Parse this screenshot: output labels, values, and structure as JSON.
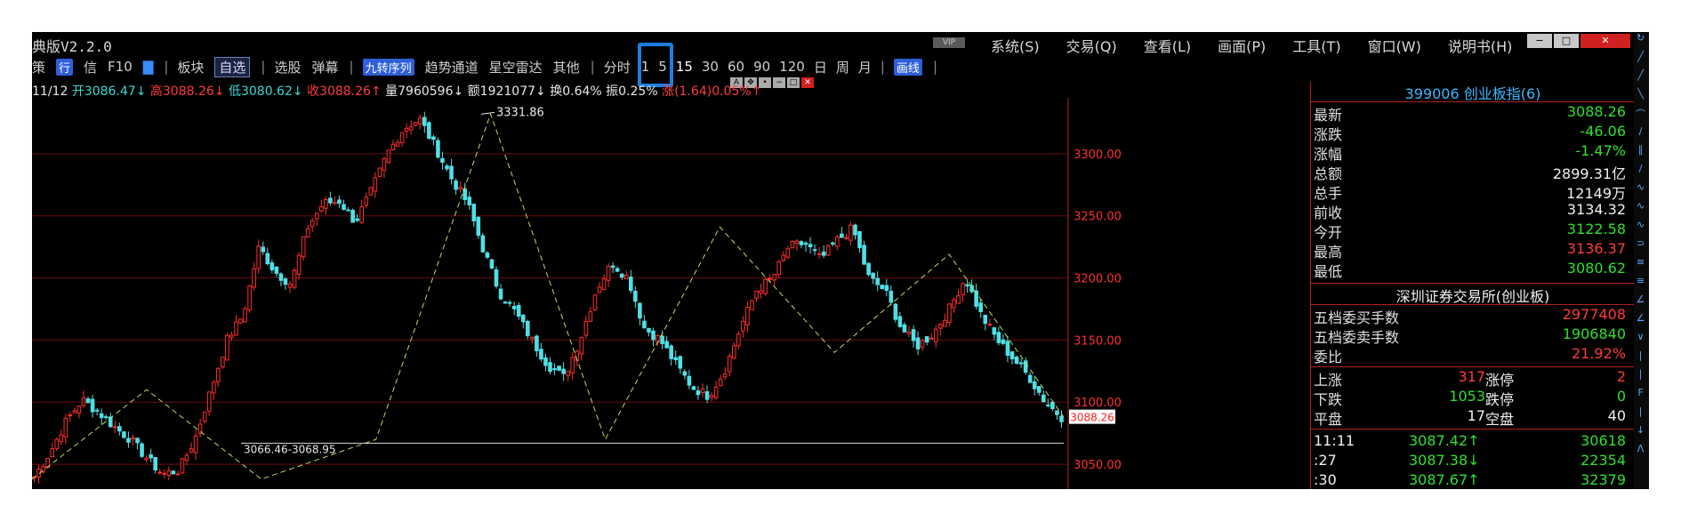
{
  "app": {
    "title": "典版V2.2.0",
    "vip_badge": "VIP",
    "menu": [
      "系统(S)",
      "交易(Q)",
      "查看(L)",
      "画面(P)",
      "工具(T)",
      "窗口(W)",
      "说明书(H)"
    ],
    "window_controls": [
      "−",
      "□",
      "✕"
    ]
  },
  "toolbar": {
    "items_left": [
      "策",
      "行",
      "信",
      "F10",
      "▇"
    ],
    "bankuai": "板块",
    "zixuan": "自选",
    "xuangu": "选股",
    "danmu": "弹幕",
    "jiuzhuan": "九转序列",
    "qushi": "趋势通道",
    "xingkong": "星空雷达",
    "qita": "其他",
    "fenshi": "分时",
    "periods": [
      "1",
      "5",
      "15",
      "30",
      "60",
      "90",
      "120",
      "日",
      "周",
      "月"
    ],
    "selected_period": "15",
    "huaxian": "画线"
  },
  "info_line": {
    "date": "11/12",
    "open": "开3086.47↓",
    "high": "高3088.26↓",
    "low": "低3080.62↓",
    "close": "收3088.26↑",
    "volume": "量7960596↓",
    "amount": "额1921077↓",
    "turnover": "换0.64%",
    "amplitude": "振0.25%",
    "change": "涨(1.64)0.05%↑"
  },
  "chart_data": {
    "type": "candlestick",
    "ylim": [
      3030,
      3345
    ],
    "y_ticks": [
      3050,
      3100,
      3150,
      3200,
      3250,
      3300
    ],
    "y_tick_labels": [
      "3050.00",
      "3100.00",
      "3150.00",
      "3200.00",
      "3250.00",
      "3300.00"
    ],
    "last_price_label": "3088.26",
    "annotations": [
      {
        "text": "3331.86",
        "value": 3331.86
      },
      {
        "text": "3066.46-3068.95",
        "value": 3067
      }
    ],
    "zigzag": [
      3038,
      3110,
      3038,
      3070,
      3332,
      3070,
      3241,
      3140,
      3219,
      3088
    ],
    "close_path": [
      3040,
      3060,
      3085,
      3102,
      3092,
      3080,
      3070,
      3055,
      3042,
      3045,
      3070,
      3110,
      3150,
      3170,
      3225,
      3205,
      3195,
      3240,
      3260,
      3262,
      3245,
      3270,
      3300,
      3320,
      3328,
      3305,
      3280,
      3260,
      3222,
      3188,
      3172,
      3150,
      3130,
      3120,
      3150,
      3190,
      3212,
      3200,
      3160,
      3150,
      3130,
      3112,
      3105,
      3125,
      3160,
      3190,
      3200,
      3225,
      3228,
      3215,
      3230,
      3240,
      3200,
      3190,
      3160,
      3145,
      3155,
      3175,
      3200,
      3170,
      3150,
      3135,
      3120,
      3100,
      3088
    ]
  },
  "panel": {
    "header": "399006 创业板指(6)",
    "quote": [
      {
        "k": "最新",
        "v": "3088.26",
        "c": "g"
      },
      {
        "k": "涨跌",
        "v": "-46.06",
        "c": "g"
      },
      {
        "k": "涨幅",
        "v": "-1.47%",
        "c": "g"
      },
      {
        "k": "总额",
        "v": "2899.31亿",
        "c": "wh"
      },
      {
        "k": "总手",
        "v": "12149万",
        "c": "wh"
      },
      {
        "k": "前收",
        "v": "3134.32",
        "c": "wh"
      },
      {
        "k": "今开",
        "v": "3122.58",
        "c": "g"
      },
      {
        "k": "最高",
        "v": "3136.37",
        "c": "r"
      },
      {
        "k": "最低",
        "v": "3080.62",
        "c": "g"
      }
    ],
    "exchange": "深圳证券交易所(创业板)",
    "orders": [
      {
        "k": "五档委买手数",
        "v": "2977408",
        "c": "r"
      },
      {
        "k": "五档委卖手数",
        "v": "1906840",
        "c": "g"
      },
      {
        "k": "委比",
        "v": "21.92%",
        "c": "r"
      }
    ],
    "breadth": [
      {
        "k": "上涨",
        "n": "317",
        "nc": "r",
        "k2": "涨停",
        "v": "2",
        "c": "r"
      },
      {
        "k": "下跌",
        "n": "1053",
        "nc": "g",
        "k2": "跌停",
        "v": "0",
        "c": "g"
      },
      {
        "k": "平盘",
        "n": "17",
        "nc": "wh",
        "k2": "空盘",
        "v": "40",
        "c": "wh"
      }
    ],
    "ticks": [
      {
        "t": "11:11",
        "p": "3087.42↑",
        "v": "30618"
      },
      {
        "t": ":27",
        "p": "3087.38↓",
        "v": "22354"
      },
      {
        "t": ":30",
        "p": "3087.67↑",
        "v": "32379"
      }
    ]
  }
}
